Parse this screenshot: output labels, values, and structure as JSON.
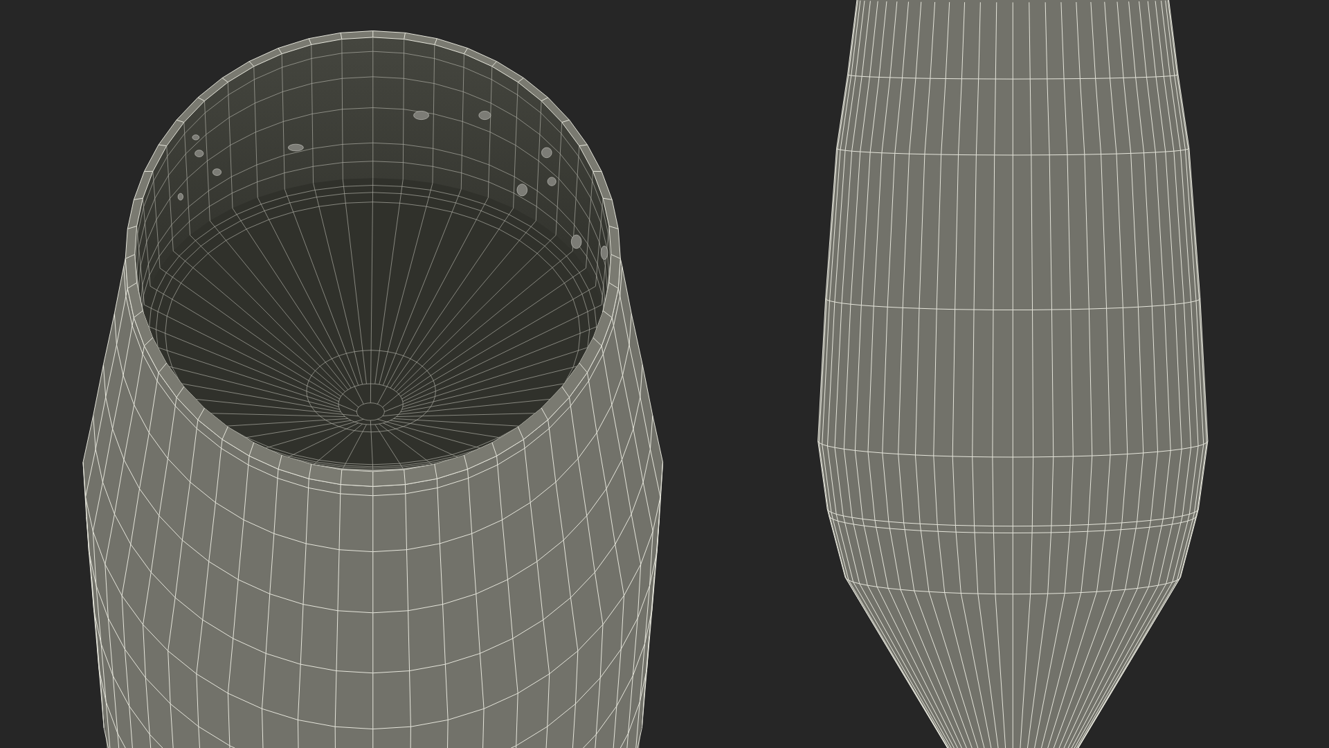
{
  "scene": {
    "objects": [
      {
        "kind": "open-cylinder"
      },
      {
        "kind": "tapered-vessel"
      }
    ]
  }
}
